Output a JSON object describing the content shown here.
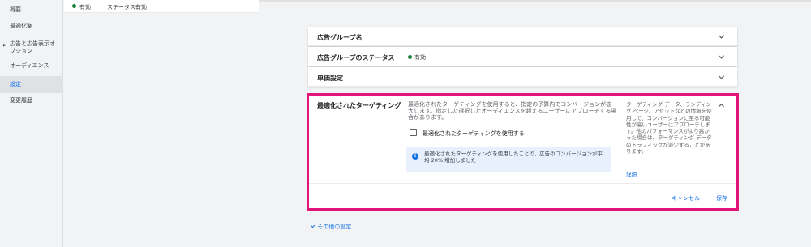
{
  "sidebar": {
    "items": [
      {
        "label": "概要"
      },
      {
        "label": "最適化案"
      },
      {
        "label": "広告と広告表示オプション"
      },
      {
        "label": "オーディエンス"
      },
      {
        "label": "設定"
      },
      {
        "label": "変更履歴"
      }
    ]
  },
  "topbar": {
    "status1": "有効",
    "status2_label": "ステータス:",
    "status2_value": "有効"
  },
  "panels": {
    "ad_group_name": {
      "title": "広告グループ名"
    },
    "ad_group_status": {
      "title": "広告グループのステータス",
      "value": "有効"
    },
    "bid": {
      "title": "単価設定"
    }
  },
  "optimized_targeting": {
    "title": "最適化されたターゲティング",
    "description": "最適化されたターゲティングを使用すると、指定の予算内でコンバージョンが拡大します。指定した選択したオーディエンスを超えるユーザーにアプローチする場合があります。",
    "checkbox_label": "最適化されたターゲティングを使用する",
    "info_text": "最適化されたターゲティングを使用したことで、広告のコンバージョンが平均 20% 増加しました",
    "help_text": "ターゲティング データ、ランディング ページ、アセットなどの情報を使用して、コンバージョンに至る可能性が高いユーザーにアプローチします。他のパフォーマンスがより高かった場合は、ターゲティング データのトラフィックが減少することがあります。",
    "help_link": "詳細",
    "cancel_label": "キャンセル",
    "save_label": "保存"
  },
  "other_settings": {
    "label": "その他の設定"
  },
  "colors": {
    "accent": "#1a73e8",
    "highlight_border": "#e0147a",
    "status_green": "#188038"
  },
  "icons": {
    "chevron_down": "chevron-down-icon",
    "chevron_up": "chevron-up-icon",
    "info": "info-icon",
    "status_dot": "status-dot-icon"
  }
}
